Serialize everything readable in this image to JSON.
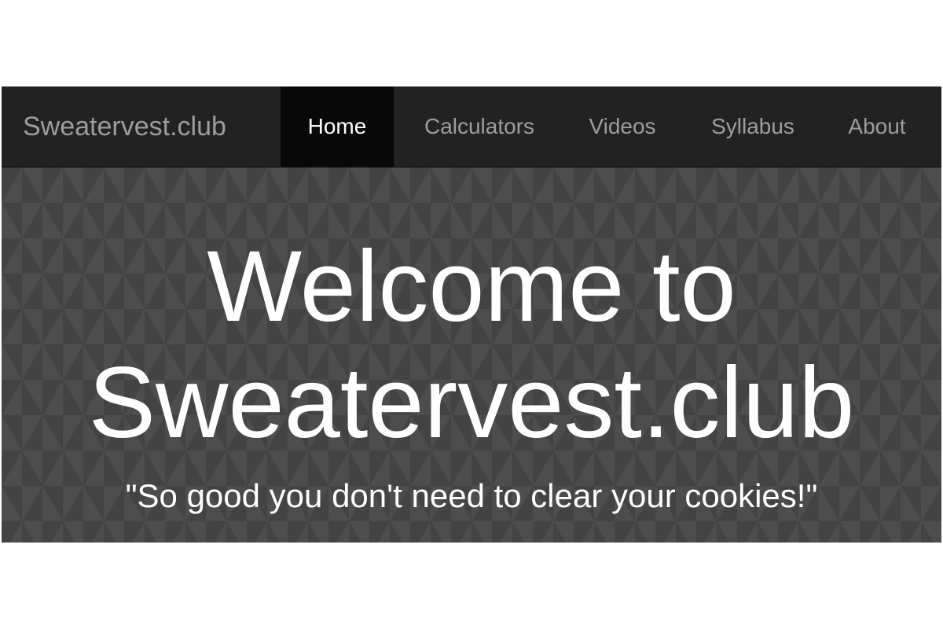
{
  "navbar": {
    "brand": "Sweatervest.club",
    "items": [
      {
        "label": "Home",
        "active": true
      },
      {
        "label": "Calculators",
        "active": false
      },
      {
        "label": "Videos",
        "active": false
      },
      {
        "label": "Syllabus",
        "active": false
      },
      {
        "label": "About",
        "active": false
      }
    ]
  },
  "hero": {
    "title_line1": "Welcome to",
    "title_line2": "Sweatervest.club",
    "tagline": "\"So good you don't need to clear your cookies!\""
  },
  "colors": {
    "navbar_bg": "#222222",
    "active_item_bg": "#080808",
    "nav_text": "#9d9d9d",
    "hero_bg": "#474747",
    "hero_text": "#ffffff"
  }
}
